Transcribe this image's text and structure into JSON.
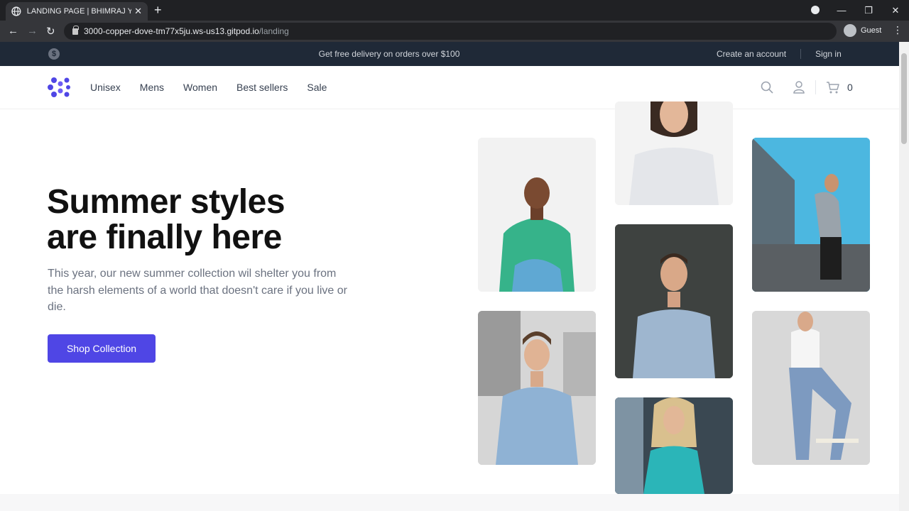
{
  "browser": {
    "tab_title": "LANDING PAGE | BHIMRAJ YADAV",
    "url_host": "3000-copper-dove-tm77x5ju.ws-us13.gitpod.io",
    "url_path": "/landing",
    "profile_label": "Guest"
  },
  "promo": {
    "message": "Get free delivery on orders over $100",
    "create_account": "Create an account",
    "sign_in": "Sign in"
  },
  "nav": {
    "links": [
      "Unisex",
      "Mens",
      "Women",
      "Best sellers",
      "Sale"
    ],
    "cart_count": "0"
  },
  "hero": {
    "title_line1": "Summer styles",
    "title_line2": "are finally here",
    "subtitle": "This year, our new summer collection wil shelter you from the harsh elements of a world that doesn't care if you live or die.",
    "cta": "Shop Collection"
  },
  "colors": {
    "accent": "#4f46e5",
    "promo_bg": "#1f2937"
  }
}
